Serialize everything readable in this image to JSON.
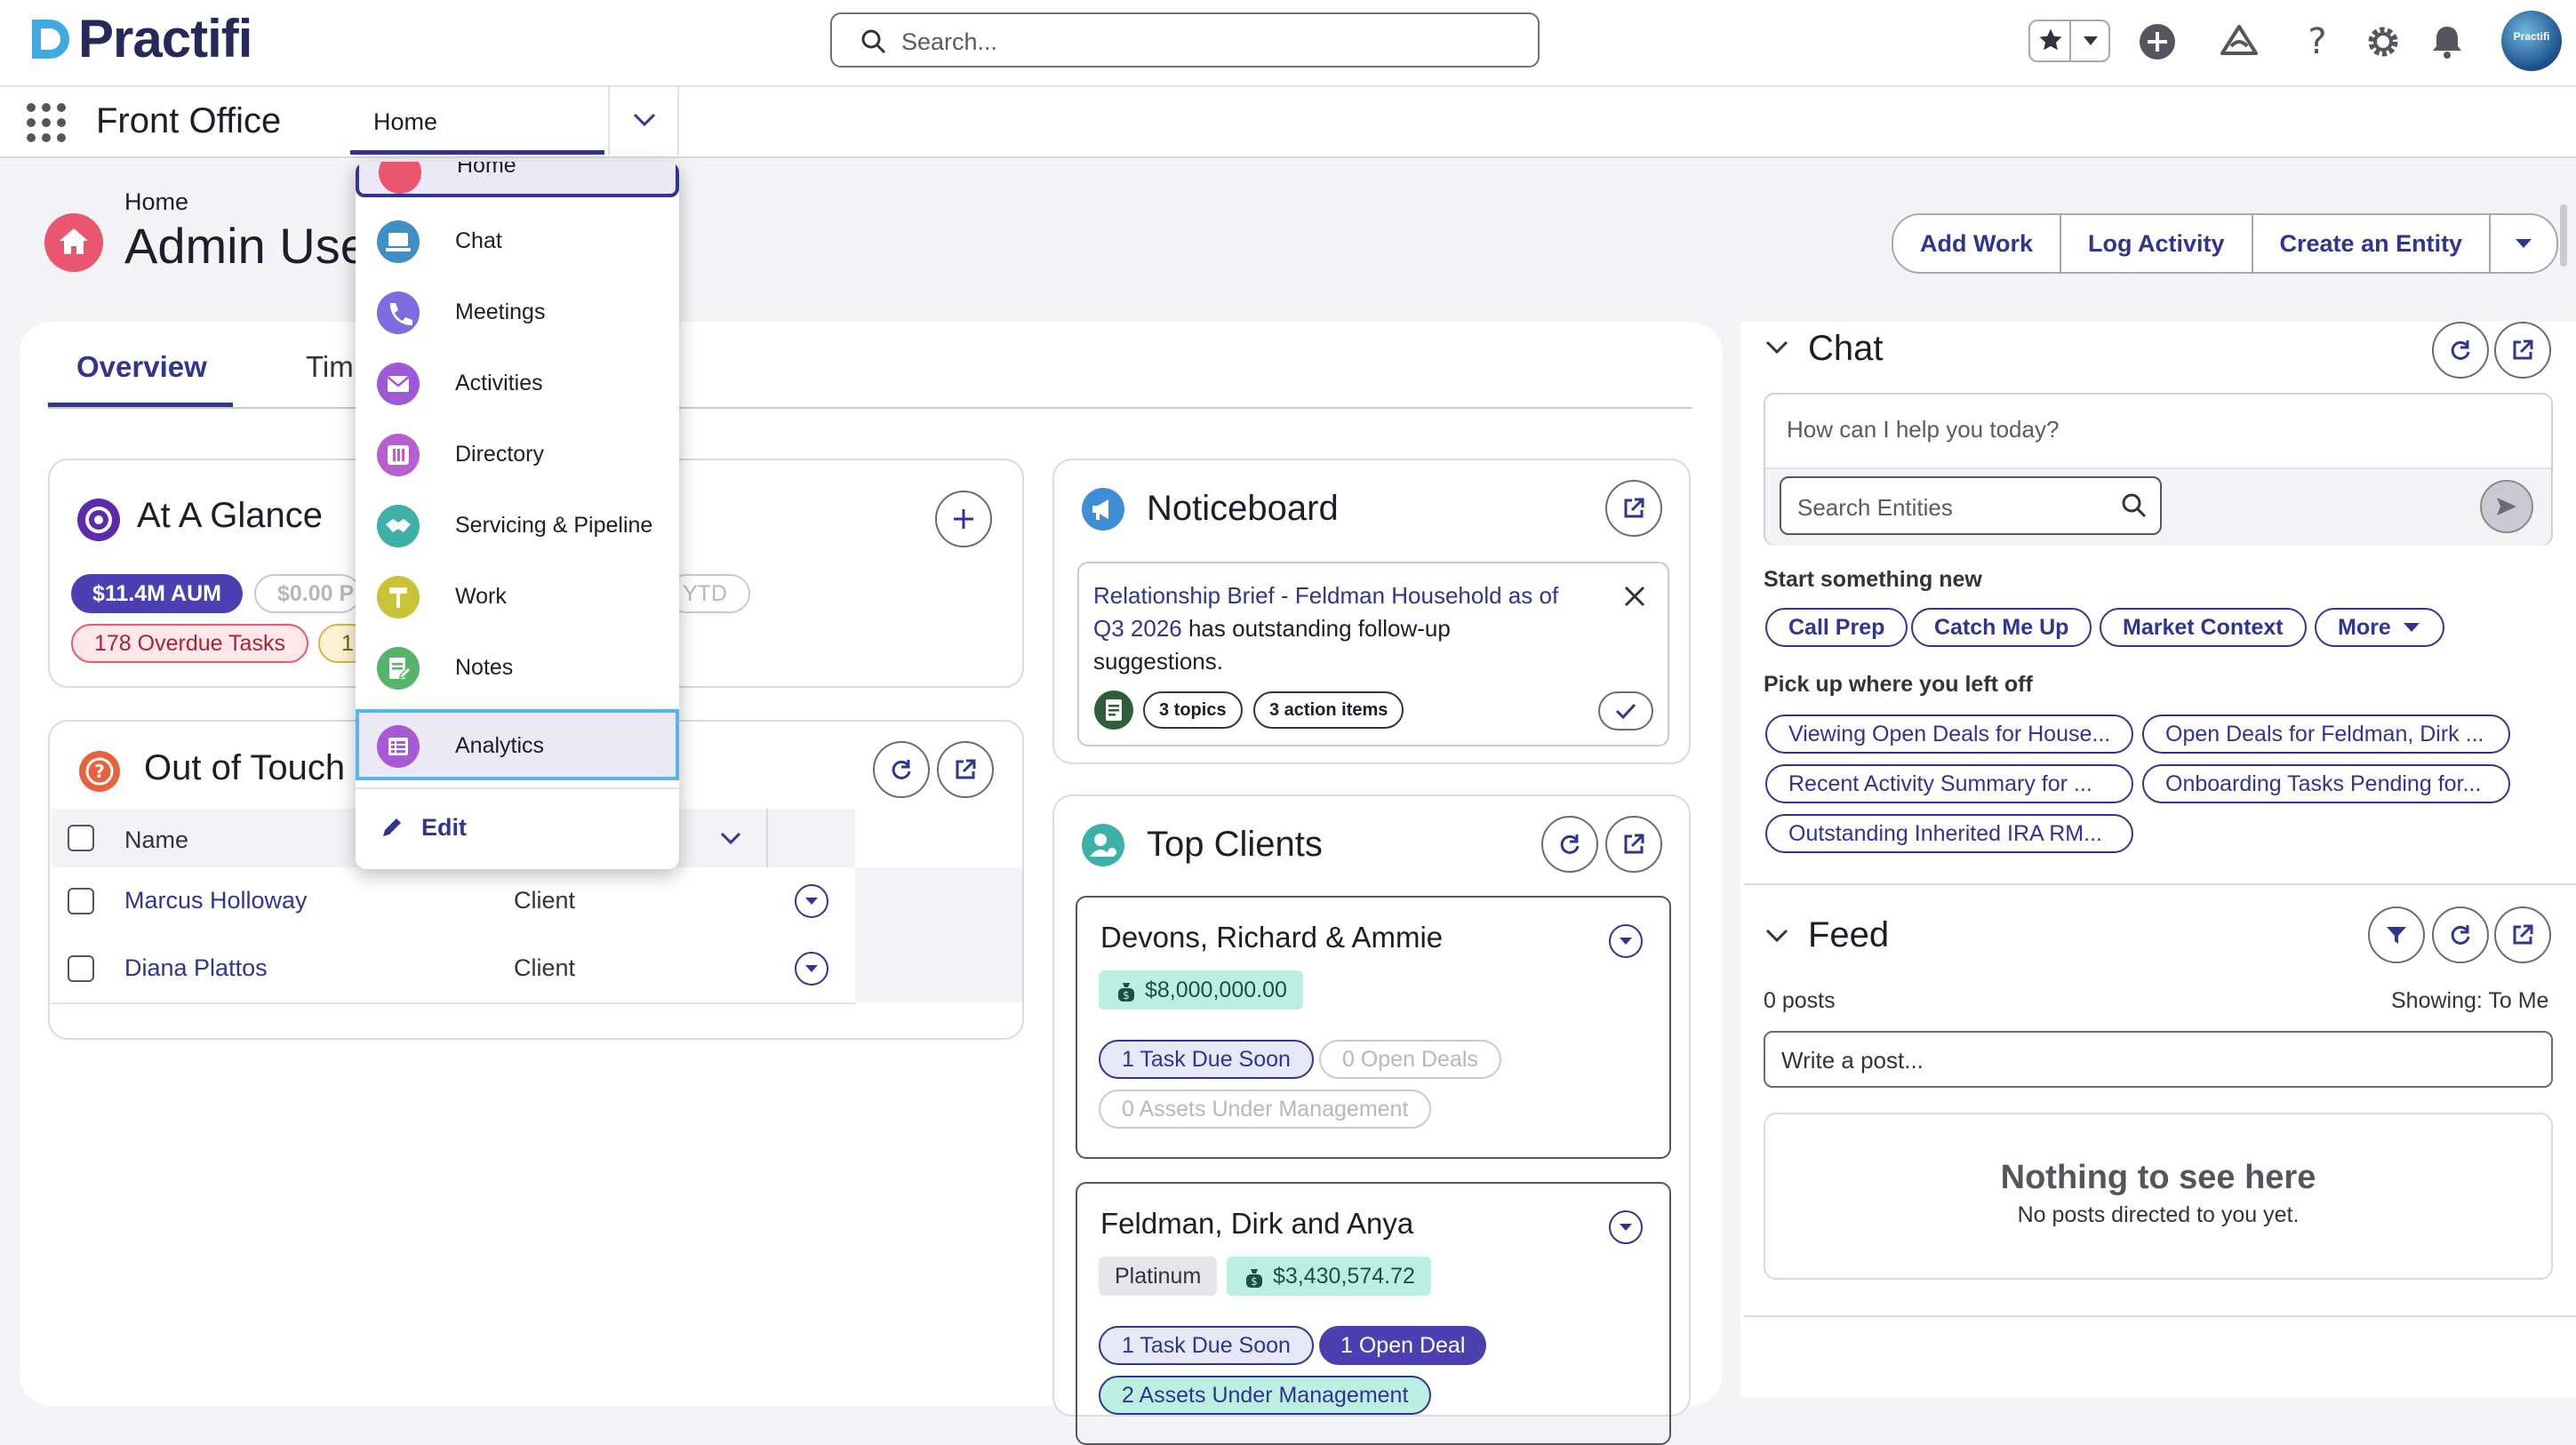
{
  "brand": {
    "name": "Practifi",
    "accent": "#2f3590",
    "logo_color": "#3fa9e0"
  },
  "search": {
    "placeholder": "Search..."
  },
  "avatar_label": "Practifi",
  "nav": {
    "app_name": "Front Office",
    "current_tab": "Home"
  },
  "header": {
    "breadcrumb": "Home",
    "title": "Admin Use"
  },
  "actions": {
    "add_work": "Add Work",
    "log_activity": "Log Activity",
    "create_entity": "Create an Entity"
  },
  "tabs": {
    "overview": "Overview",
    "timeline": "Tim"
  },
  "at_a_glance": {
    "title": "At A Glance",
    "aum": "$11.4M AUM",
    "pill2": "$0.00 P",
    "pill3": "YTD",
    "overdue": "178 Overdue Tasks",
    "pill5": "1"
  },
  "out_of_touch": {
    "title": "Out of Touch",
    "columns": {
      "name": "Name"
    },
    "rows": [
      {
        "name": "Marcus Holloway",
        "type": "Client"
      },
      {
        "name": "Diana Plattos",
        "type": "Client"
      }
    ]
  },
  "nav_menu": {
    "items": [
      {
        "label": "Home",
        "icon": "home-icon",
        "color": "#e9566e"
      },
      {
        "label": "Chat",
        "icon": "laptop-icon",
        "color": "#3e8fc4"
      },
      {
        "label": "Meetings",
        "icon": "phone-icon",
        "color": "#7d6be0"
      },
      {
        "label": "Activities",
        "icon": "mail-icon",
        "color": "#9e59d8"
      },
      {
        "label": "Directory",
        "icon": "book-icon",
        "color": "#b85ed0"
      },
      {
        "label": "Servicing & Pipeline",
        "icon": "handshake-icon",
        "color": "#3fb0a6"
      },
      {
        "label": "Work",
        "icon": "hammer-icon",
        "color": "#c7c43a"
      },
      {
        "label": "Notes",
        "icon": "notes-icon",
        "color": "#56b46a"
      },
      {
        "label": "Analytics",
        "icon": "report-icon",
        "color": "#a85ad6"
      }
    ],
    "edit_label": "Edit"
  },
  "noticeboard": {
    "title": "Noticeboard",
    "notice_link": "Relationship Brief - Feldman Household as of Q3 2026",
    "notice_link_line1": "Relationship Brief - Feldman Household as of",
    "notice_link_line2": "Q3 2026",
    "notice_rest_line1": " has outstanding follow-up",
    "notice_rest_line2": "suggestions.",
    "topics": "3 topics",
    "action_items": "3 action items"
  },
  "top_clients": {
    "title": "Top Clients",
    "clients": [
      {
        "name": "Devons, Richard & Ammie",
        "value": "$8,000,000.00",
        "task": "1 Task Due Soon",
        "deals": "0 Open Deals",
        "aum": "0 Assets Under Management"
      },
      {
        "name": "Feldman, Dirk and Anya",
        "tier": "Platinum",
        "value": "$3,430,574.72",
        "task": "1 Task Due Soon",
        "deals": "1 Open Deal",
        "aum": "2 Assets Under Management"
      }
    ]
  },
  "chat": {
    "title": "Chat",
    "prompt_placeholder": "How can I help you today?",
    "entity_search_placeholder": "Search Entities",
    "start_heading": "Start something new",
    "start_chips": [
      "Call Prep",
      "Catch Me Up",
      "Market Context",
      "More"
    ],
    "resume_heading": "Pick up where you left off",
    "resume_chips": [
      "Viewing Open Deals for House...",
      "Open Deals for Feldman, Dirk ...",
      "Recent Activity Summary for ...",
      "Onboarding Tasks Pending for...",
      "Outstanding Inherited IRA RM..."
    ]
  },
  "feed": {
    "title": "Feed",
    "posts": "0 posts",
    "showing": "Showing: To Me",
    "post_placeholder": "Write a post...",
    "empty_title": "Nothing to see here",
    "empty_sub": "No posts directed to you yet."
  }
}
